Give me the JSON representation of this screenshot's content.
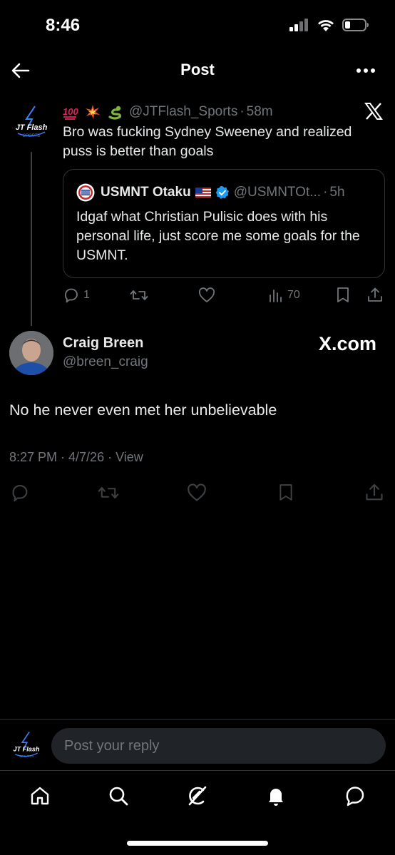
{
  "status_bar": {
    "time": "8:46"
  },
  "header": {
    "title": "Post"
  },
  "parent_post": {
    "emojis": [
      "hundred-points-icon",
      "collision-icon",
      "snake-icon"
    ],
    "avatar_text": [
      "JT Flash",
      "SPORTS"
    ],
    "handle": "@JTFlash_Sports",
    "separator": "·",
    "time": "58m",
    "text": "Bro was fucking Sydney Sweeney and realized puss is better than goals",
    "quote": {
      "name": "USMNT Otaku",
      "handle": "@USMNTOt...",
      "separator": "·",
      "time": "5h",
      "text": "Idgaf what Christian Pulisic does with his personal life, just score me some goals for the USMNT."
    },
    "actions": {
      "replies": "1",
      "views": "70"
    }
  },
  "main_post": {
    "name": "Craig Breen",
    "handle": "@breen_craig",
    "watermark": "X.com",
    "text": "No he never even met her unbelievable",
    "meta": "8:27 PM · 4/7/26 · View"
  },
  "reply_bar": {
    "placeholder": "Post your reply"
  },
  "colors": {
    "background": "#000000",
    "text": "#e7e9ea",
    "muted": "#71767b",
    "verified": "#1d9bf0",
    "border": "#2f3336"
  }
}
